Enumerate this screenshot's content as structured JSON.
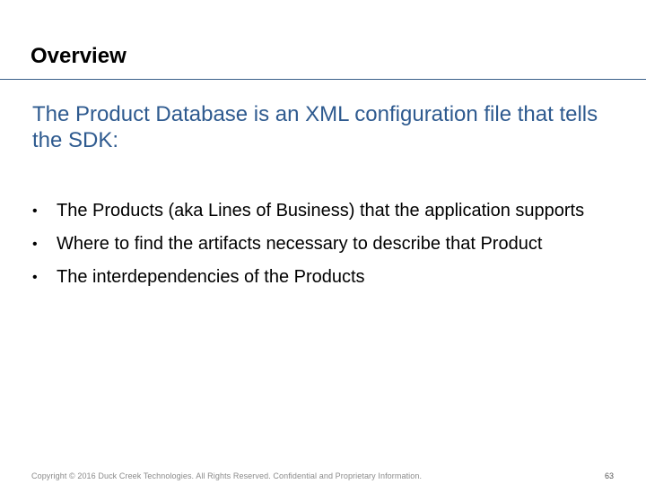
{
  "slide": {
    "title": "Overview",
    "subtitle": "The Product Database is an XML configuration file that tells the SDK:",
    "bullets": [
      "The Products (aka Lines of Business) that the application supports",
      "Where to find the artifacts necessary to describe that Product",
      "The interdependencies of the Products"
    ],
    "bullet_glyph": "•",
    "footer": "Copyright © 2016 Duck Creek Technologies. All Rights Reserved. Confidential and Proprietary Information.",
    "page_number": "63"
  },
  "colors": {
    "title": "#000000",
    "subtitle": "#2e5a8f",
    "rule": "#3a5f8a",
    "footer": "#8a8a8a"
  }
}
